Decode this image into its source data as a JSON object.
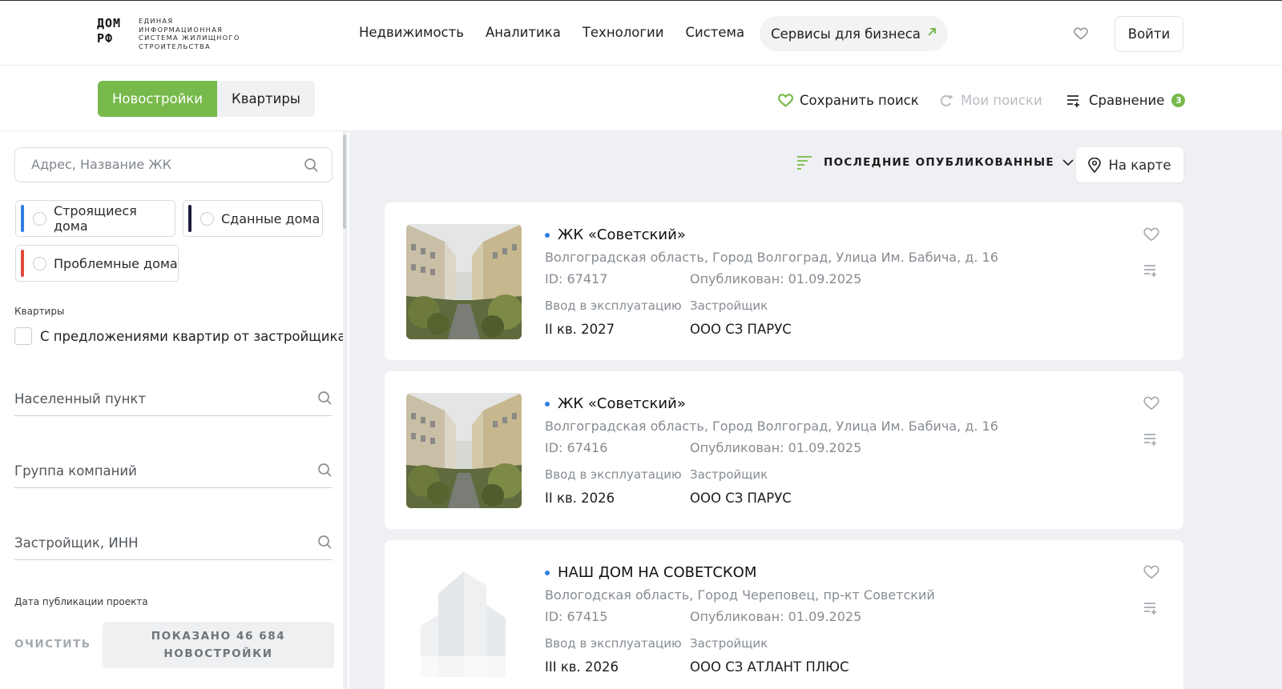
{
  "logo": {
    "mark_top": "ДОМ",
    "mark_bottom": "РФ",
    "text": "Единая информационная система жилищного строительства"
  },
  "nav": [
    "Недвижимость",
    "Аналитика",
    "Технологии",
    "Система"
  ],
  "business_button": "Сервисы для бизнеса",
  "login_button": "Войти",
  "tabs": {
    "active": "Новостройки",
    "inactive": "Квартиры"
  },
  "tools": {
    "save_search": "Сохранить поиск",
    "my_searches": "Мои поиски",
    "compare": "Сравнение",
    "compare_count": "3"
  },
  "filters": {
    "search_placeholder": "Адрес, Название ЖК",
    "chips": [
      {
        "label": "Строящиеся дома",
        "color": "#2f7fe0"
      },
      {
        "label": "Сданные дома",
        "color": "#1c1c3a"
      },
      {
        "label": "Проблемные дома",
        "color": "#e04a3a"
      }
    ],
    "apartments_label": "Квартиры",
    "offers_checkbox": "С предложениями квартир от застройщика",
    "locality_placeholder": "Населенный пункт",
    "company_group_placeholder": "Группа компаний",
    "developer_placeholder": "Застройщик, ИНН",
    "publication_date_label": "Дата публикации проекта",
    "clear": "ОЧИСТИТЬ",
    "shown_line1": "ПОКАЗАНО 46 684",
    "shown_line2": "НОВОСТРОЙКИ"
  },
  "sort": {
    "label": "ПОСЛЕДНИЕ ОПУБЛИКОВАННЫЕ"
  },
  "map_button": "На карте",
  "accent_color": "#77b94a",
  "cards": [
    {
      "title": "ЖК «Советский»",
      "address": "Волгоградская область, Город Волгоград, Улица Им. Бабича, д. 16",
      "id": "ID: 67417",
      "published": "Опубликован: 01.09.2025",
      "commission_label": "Ввод в эксплуатацию",
      "commission_value": "II кв. 2027",
      "developer_label": "Застройщик",
      "developer_value": "ООО СЗ ПАРУС",
      "image": "photo"
    },
    {
      "title": "ЖК «Советский»",
      "address": "Волгоградская область, Город Волгоград, Улица Им. Бабича, д. 16",
      "id": "ID: 67416",
      "published": "Опубликован: 01.09.2025",
      "commission_label": "Ввод в эксплуатацию",
      "commission_value": "II кв. 2026",
      "developer_label": "Застройщик",
      "developer_value": "ООО СЗ ПАРУС",
      "image": "photo"
    },
    {
      "title": "НАШ ДОМ НА СОВЕТСКОМ",
      "address": "Вологодская область, Город Череповец, пр-кт Советский",
      "id": "ID: 67415",
      "published": "Опубликован: 01.09.2025",
      "commission_label": "Ввод в эксплуатацию",
      "commission_value": "III кв. 2026",
      "developer_label": "Застройщик",
      "developer_value": "ООО СЗ АТЛАНТ ПЛЮС",
      "image": "placeholder"
    }
  ]
}
